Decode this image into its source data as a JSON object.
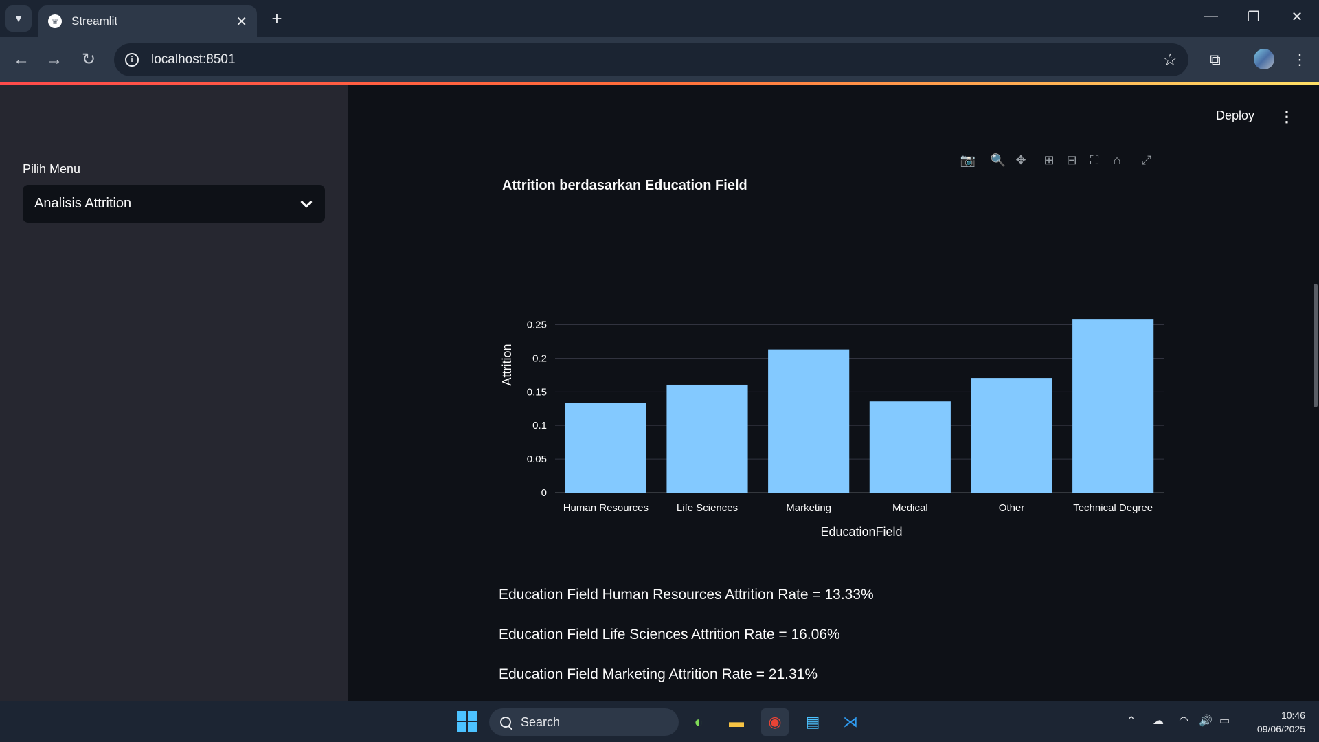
{
  "browser": {
    "tab_title": "Streamlit",
    "tab_close": "✕",
    "new_tab": "+",
    "url": "localhost:8501"
  },
  "sidebar": {
    "label": "Pilih Menu",
    "selected": "Analisis Attrition"
  },
  "header": {
    "deploy_label": "Deploy",
    "menu_glyph": "⋮"
  },
  "chart_data": {
    "type": "bar",
    "title": "Attrition berdasarkan Education Field",
    "xlabel": "EducationField",
    "ylabel": "Attrition",
    "categories": [
      "Human Resources",
      "Life Sciences",
      "Marketing",
      "Medical",
      "Other",
      "Technical Degree"
    ],
    "values": [
      0.1333,
      0.1606,
      0.2131,
      0.1358,
      0.1707,
      0.2576
    ],
    "ylim": [
      0,
      0.27
    ],
    "yticks": [
      0,
      0.05,
      0.1,
      0.15,
      0.2,
      0.25
    ],
    "ytick_labels": [
      "0",
      "0.05",
      "0.1",
      "0.15",
      "0.2",
      "0.25"
    ],
    "grid": true,
    "bar_color": "#83c9ff"
  },
  "stats": [
    "Education Field Human Resources Attrition Rate = 13.33%",
    "Education Field Life Sciences Attrition Rate = 16.06%",
    "Education Field Marketing Attrition Rate = 21.31%"
  ],
  "taskbar": {
    "search_label": "Search",
    "time": "10:46",
    "date": "09/06/2025"
  },
  "colors": {
    "background": "#0e1117",
    "sidebar": "#262730",
    "accent": "#ff4b4b"
  }
}
